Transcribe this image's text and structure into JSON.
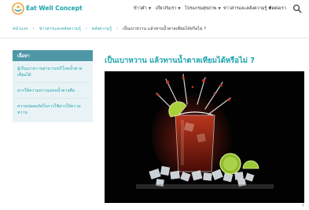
{
  "header": {
    "brand": "Eat Well Concept",
    "nav": [
      {
        "label": "ข้าวคำ"
      },
      {
        "label": "เกี่ยวกับเรา"
      },
      {
        "label": "โปรแกรมสุขภาพ"
      },
      {
        "label": "ข่าวสารและคลังความรู้"
      },
      {
        "label": "ติดต่อเรา"
      }
    ]
  },
  "breadcrumb": {
    "items": [
      "หน้าแรก",
      "ข่าวสารและคลังความรู้",
      "คลังความรู้"
    ],
    "current": "เป็นเบาหวาน แล้วทานน้ำตาลเทียมได้หรือไม่ ?"
  },
  "sidebar": {
    "heading": "เนื้อหา",
    "items": [
      {
        "label": "ผู้เป็นเบาหวานสามารถบริโภคน้ำตาลเทียมได้"
      },
      {
        "label": "สารให้ความหวานแทนน้ำตาลคือ"
      },
      {
        "label": "ความปลอดภัยในการใช้สารให้ความหวาน"
      }
    ]
  },
  "article": {
    "title": "เป็นเบาหวาน แล้วทานน้ำตาลเทียมได้หรือไม่ ?"
  },
  "scroll_top": "↑",
  "colors": {
    "accent": "#1aa3ad",
    "sidebar_header": "#4e97a7",
    "sidebar_bg": "#e9f3f5",
    "logo_orange": "#f2a33a"
  },
  "icons": {
    "logo": "eat-well-logo",
    "search": "search-icon",
    "chevron": "chevron-down-icon",
    "breadcrumb_separator": "chevron-right-icon"
  }
}
